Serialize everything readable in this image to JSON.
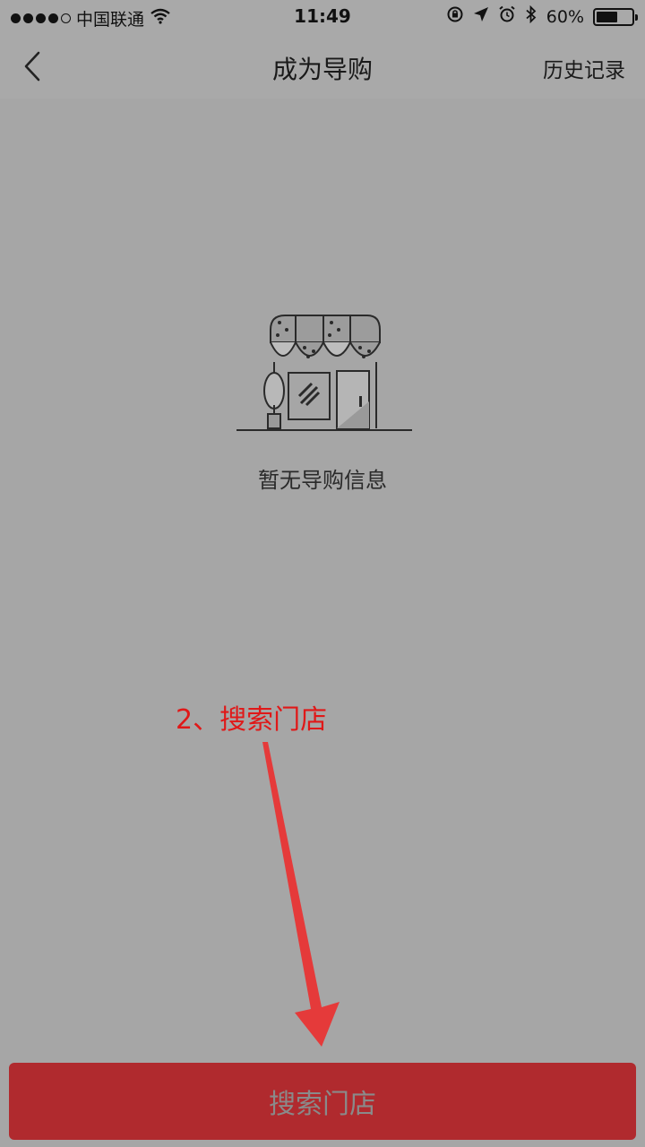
{
  "status_bar": {
    "carrier": "中国联通",
    "time": "11:49",
    "battery_percent": "60%",
    "battery_level": 0.6,
    "icons": [
      "signal-dots-icon",
      "wifi-icon",
      "orientation-lock-icon",
      "location-arrow-icon",
      "alarm-icon",
      "bluetooth-icon",
      "battery-icon"
    ]
  },
  "nav": {
    "back_icon": "chevron-left-icon",
    "title": "成为导购",
    "history_label": "历史记录"
  },
  "empty_state": {
    "icon": "storefront-icon",
    "message": "暂无导购信息"
  },
  "annotation": {
    "text": "2、搜索门店",
    "arrow_icon": "red-arrow-down-icon",
    "color": "#e01818"
  },
  "footer": {
    "search_store_label": "搜索门店",
    "button_color": "#b02a2e"
  }
}
